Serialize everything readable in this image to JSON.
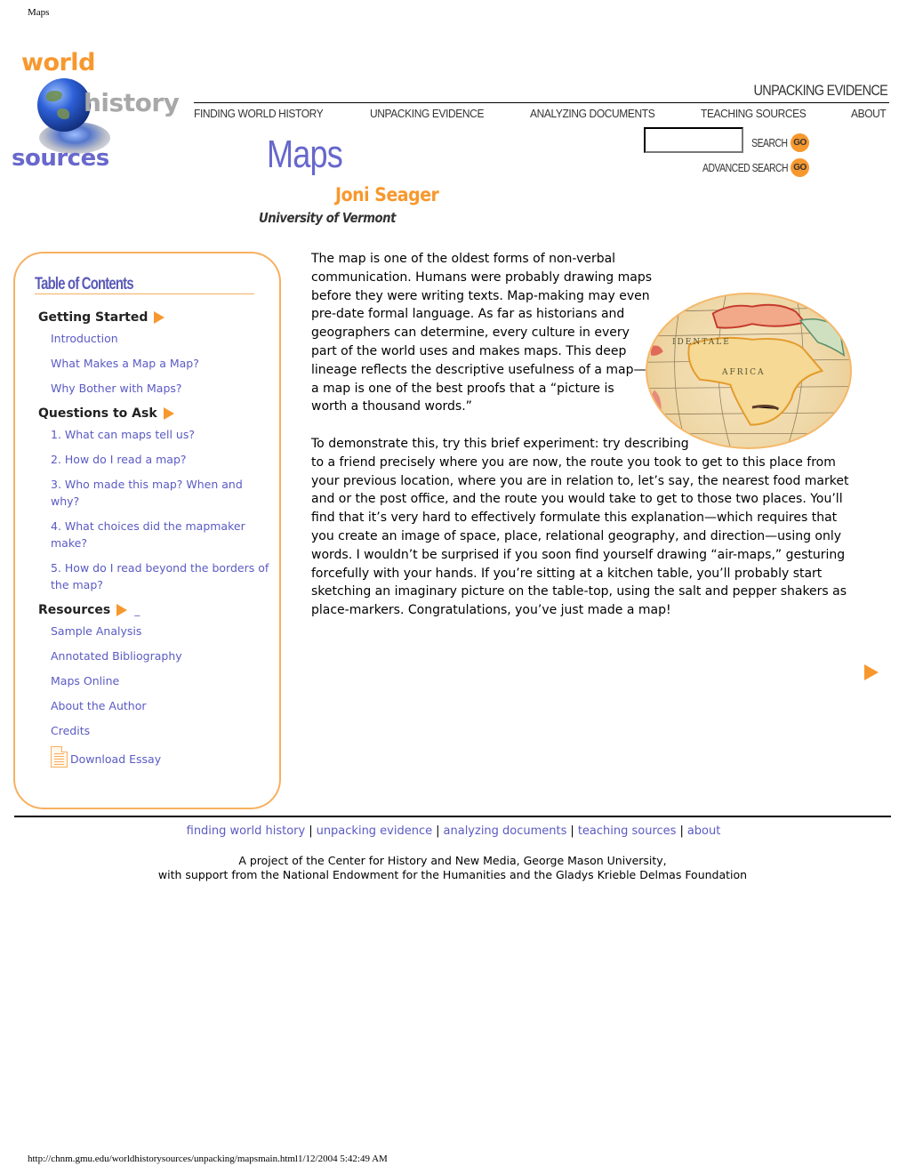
{
  "print": {
    "header": "Maps",
    "footer": "http://chnm.gmu.edu/worldhistorysources/unpacking/mapsmain.html1/12/2004 5:42:49 AM"
  },
  "logo": {
    "world": "world",
    "history": "history",
    "sources": "sources"
  },
  "section_title": "UNPACKING EVIDENCE",
  "top_nav": [
    {
      "label": "FINDING WORLD HISTORY"
    },
    {
      "label": "UNPACKING EVIDENCE"
    },
    {
      "label": "ANALYZING DOCUMENTS"
    },
    {
      "label": "TEACHING SOURCES"
    },
    {
      "label": "ABOUT"
    }
  ],
  "search": {
    "value": "",
    "search_label": "SEARCH",
    "advanced_label": "ADVANCED SEARCH",
    "go_label": "GO"
  },
  "page": {
    "title": "Maps",
    "author": "Joni Seager",
    "affiliation": "University of Vermont"
  },
  "toc": {
    "title": "Table of Contents",
    "sections": [
      {
        "heading": "Getting Started",
        "links": [
          "Introduction",
          "What Makes a Map a Map?",
          "Why Bother with Maps?"
        ]
      },
      {
        "heading": "Questions to Ask",
        "links": [
          "1. What can maps tell us?",
          "2. How do I read a map?",
          "3. Who made this map? When and why?",
          "4. What choices did the mapmaker make?",
          "5. How do I read beyond the borders of the map?"
        ]
      },
      {
        "heading": "Resources",
        "underscore": "_",
        "links": [
          "Sample Analysis",
          "Annotated Bibliography",
          "Maps Online",
          "About the Author",
          "Credits"
        ]
      }
    ],
    "download": "Download Essay"
  },
  "content": {
    "paragraphs": [
      "The map is one of the oldest forms of non-verbal communication. Humans were probably drawing maps before they were writing texts. Map-making may even pre-date formal language. As far as historians and geographers can determine, every culture in every part of the world uses and makes maps. This deep lineage reflects the descriptive usefulness of a map—a map is one of the best proofs that a “picture is worth a thousand words.”",
      "To demonstrate this, try this brief experiment: try describing to a friend precisely where you are now, the route you took to get to this place from your previous location, where you are in relation to, let’s say, the nearest food market and or the post office, and the route you would take to get to those two places. You’ll find that it’s very hard to effectively formulate this explanation—which requires that you create an image of space, place, relational geography, and direction—using only words. I wouldn’t be surprised if you soon find yourself drawing “air-maps,” gesturing forcefully with your hands. If you’re sitting at a kitchen table, you’ll probably start sketching an imaginary picture on the table-top, using the salt and pepper shakers as place-markers. Congratulations, you’ve just made a map!"
    ],
    "map_labels": {
      "africa": "AFRICA",
      "occidentale": "IDENTALE"
    }
  },
  "footer": {
    "nav": [
      {
        "label": "finding world history"
      },
      {
        "label": "unpacking evidence"
      },
      {
        "label": "analyzing documents"
      },
      {
        "label": "teaching sources"
      },
      {
        "label": "about"
      }
    ],
    "separator": "|",
    "credit_line1": "A project of the Center for History and New Media, George Mason University,",
    "credit_line2": "with support from the National Endowment for the Humanities and the Gladys Krieble Delmas Foundation"
  },
  "colors": {
    "accent_orange": "#f7982e",
    "link_blue": "#5a5ac4",
    "title_blue": "#6767cc"
  }
}
